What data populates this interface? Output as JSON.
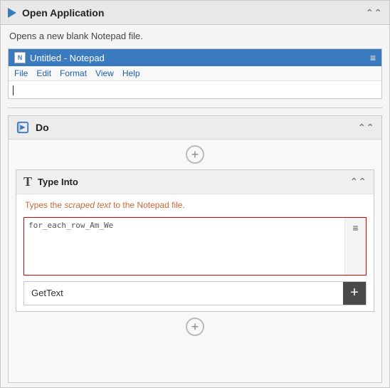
{
  "header": {
    "title": "Open Application",
    "collapse_icon": "⌃⌃",
    "description": "Opens a new blank Notepad file."
  },
  "notepad": {
    "title": "Untitled - Notepad",
    "icon_label": "N",
    "menu_icon": "≡",
    "menu_items": [
      "File",
      "Edit",
      "Format",
      "View",
      "Help"
    ]
  },
  "do_section": {
    "title": "Do",
    "collapse_icon": "⌃⌃"
  },
  "add_button_top": "+",
  "type_into": {
    "title": "Type Into",
    "collapse_icon": "⌃⌃",
    "description_prefix": "Types the ",
    "description_highlight": "scraped text",
    "description_suffix": " to the Notepad file.",
    "input_text": "for_each_row_Am_We",
    "side_icon": "≡",
    "gettext_label": "GetText",
    "gettext_plus": "+"
  },
  "add_button_bottom": "+"
}
